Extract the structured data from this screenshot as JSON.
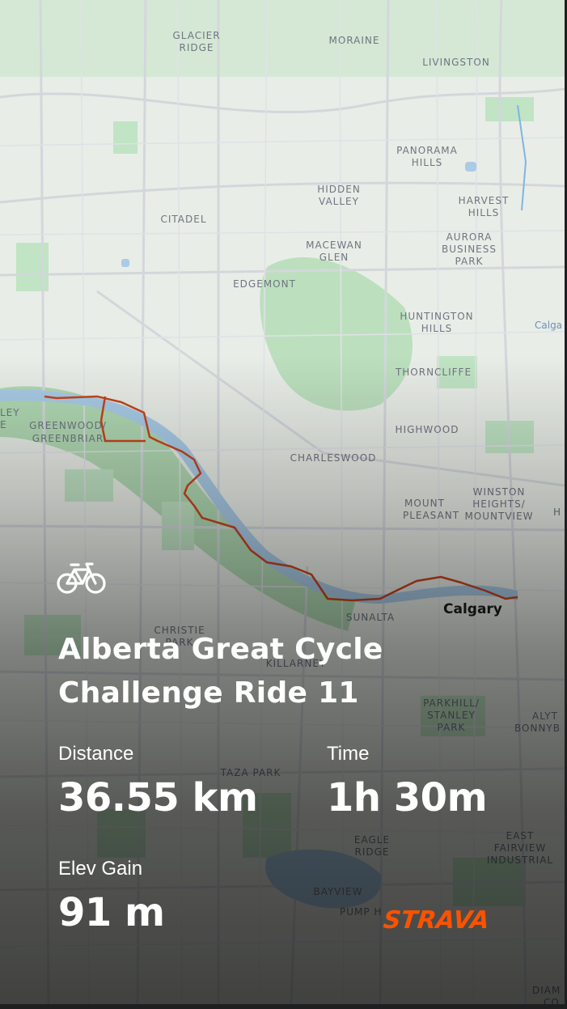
{
  "map": {
    "places": [
      {
        "id": "glacier-ridge",
        "lines": [
          "GLACIER",
          "RIDGE"
        ]
      },
      {
        "id": "moraine",
        "lines": [
          "MORAINE"
        ]
      },
      {
        "id": "livingston",
        "lines": [
          "LIVINGSTON"
        ]
      },
      {
        "id": "panorama-hills",
        "lines": [
          "PANORAMA",
          "HILLS"
        ]
      },
      {
        "id": "hidden-valley",
        "lines": [
          "HIDDEN",
          "VALLEY"
        ]
      },
      {
        "id": "harvest-hills",
        "lines": [
          "HARVEST",
          "HILLS"
        ]
      },
      {
        "id": "citadel",
        "lines": [
          "CITADEL"
        ]
      },
      {
        "id": "aurora-business-park",
        "lines": [
          "AURORA",
          "BUSINESS",
          "PARK"
        ]
      },
      {
        "id": "macewan-glen",
        "lines": [
          "MACEWAN",
          "GLEN"
        ]
      },
      {
        "id": "edgemont",
        "lines": [
          "EDGEMONT"
        ]
      },
      {
        "id": "huntington-hills",
        "lines": [
          "HUNTINGTON",
          "HILLS"
        ]
      },
      {
        "id": "calgary-edge",
        "lines": [
          "Calga"
        ]
      },
      {
        "id": "thorncliffe",
        "lines": [
          "THORNCLIFFE"
        ]
      },
      {
        "id": "ley-edge",
        "lines": [
          "LEY",
          "E"
        ]
      },
      {
        "id": "greenwood",
        "lines": [
          "GREENWOOD/",
          "GREENBRIAR"
        ]
      },
      {
        "id": "highwood",
        "lines": [
          "HIGHWOOD"
        ]
      },
      {
        "id": "charleswood",
        "lines": [
          "CHARLESWOOD"
        ]
      },
      {
        "id": "winston-heights",
        "lines": [
          "WINSTON",
          "HEIGHTS/",
          "MOUNTVIEW"
        ]
      },
      {
        "id": "mount-pleasant",
        "lines": [
          "MOUNT",
          "PLEASANT"
        ]
      },
      {
        "id": "h-edge",
        "lines": [
          "H"
        ]
      },
      {
        "id": "calgary",
        "lines": [
          "Calgary"
        ]
      },
      {
        "id": "sunalta",
        "lines": [
          "SUNALTA"
        ]
      },
      {
        "id": "christie-park",
        "lines": [
          "CHRISTIE",
          "PARK"
        ]
      },
      {
        "id": "killarney",
        "lines": [
          "KILLARNEY"
        ]
      },
      {
        "id": "parkhill",
        "lines": [
          "PARKHILL/",
          "STANLEY",
          "PARK"
        ]
      },
      {
        "id": "alyth",
        "lines": [
          "ALYT",
          "BONNYB"
        ]
      },
      {
        "id": "taza-park",
        "lines": [
          "TAZA PARK"
        ]
      },
      {
        "id": "east-fairview",
        "lines": [
          "EAST",
          "FAIRVIEW",
          "INDUSTRIAL"
        ]
      },
      {
        "id": "eagle-ridge",
        "lines": [
          "EAGLE",
          "RIDGE"
        ]
      },
      {
        "id": "bayview",
        "lines": [
          "BAYVIEW"
        ]
      },
      {
        "id": "pump-hill",
        "lines": [
          "PUMP H"
        ]
      },
      {
        "id": "diam",
        "lines": [
          "DIAM",
          "CO"
        ]
      }
    ],
    "route_color": "#c8441a",
    "water_color": "#a9cbe6",
    "park_color": "#9fd7a6"
  },
  "activity": {
    "sport_icon": "bike-icon",
    "title_line1": "Alberta Great Cycle",
    "title_line2": "Challenge Ride 11"
  },
  "stats": {
    "distance_label": "Distance",
    "distance_value": "36.55 km",
    "time_label": "Time",
    "time_value": "1h 30m",
    "elev_label": "Elev Gain",
    "elev_value": "91 m"
  },
  "brand": {
    "logo_text": "STRAVA",
    "logo_color": "#fc5200"
  }
}
